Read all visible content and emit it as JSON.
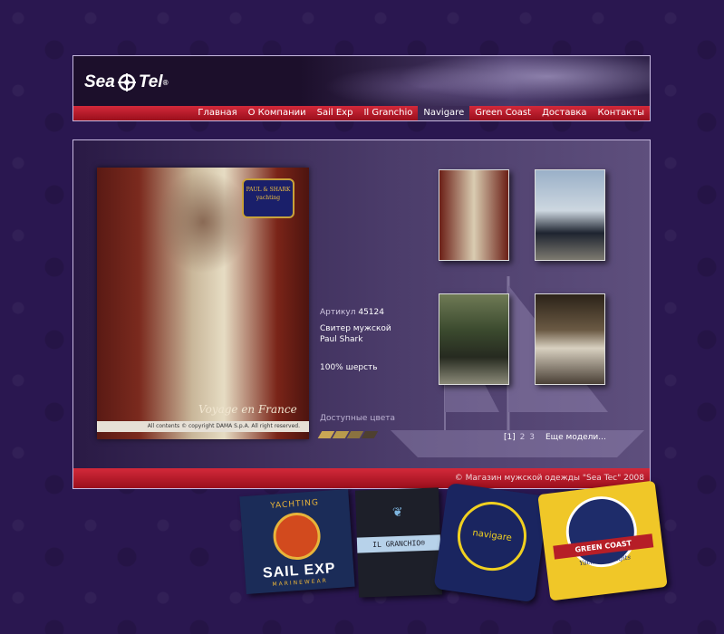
{
  "logo": {
    "text_left": "Sea",
    "text_right": "Tel",
    "mark": "®"
  },
  "nav": {
    "items": [
      {
        "label": "Главная",
        "active": false
      },
      {
        "label": "О Компании",
        "active": false
      },
      {
        "label": "Sail Exp",
        "active": false
      },
      {
        "label": "Il Granchio",
        "active": false
      },
      {
        "label": "Navigare",
        "active": true
      },
      {
        "label": "Green Coast",
        "active": false
      },
      {
        "label": "Доставка",
        "active": false
      },
      {
        "label": "Контакты",
        "active": false
      }
    ]
  },
  "product": {
    "photo": {
      "brand_badge": "PAUL & SHARK yachting",
      "caption": "Voyage en France",
      "copyright": "All contents © copyright DAMA S.p.A. All right reserved."
    },
    "article_label": "Артикул",
    "article_number": "45124",
    "name": "Свитер мужской Paul Shark",
    "material": "100% шерсть",
    "colors_label": "Доступные цвета",
    "colors": [
      "#caa654",
      "#b89a4c",
      "#8a7240",
      "#4e4030"
    ]
  },
  "thumbnails": [
    {
      "icon": "sweater-photo"
    },
    {
      "icon": "jacket-paris-photo"
    },
    {
      "icon": "dark-jacket-photo"
    },
    {
      "icon": "light-jacket-photo"
    }
  ],
  "pager": {
    "pages": [
      "[1]",
      "2",
      "3"
    ],
    "current_index": 0,
    "more_label": "Еще модели..."
  },
  "footer": {
    "text": "© Магазин мужской одежды \"Sea Tec\" 2008"
  },
  "brand_labels": {
    "sail_exp": {
      "top": "YACHTING",
      "name": "SAIL EXP",
      "sub": "MARINEWEAR"
    },
    "il_granchio": {
      "name": "IL GRANCHIO®"
    },
    "navigare": {
      "name": "navigare"
    },
    "green_coast": {
      "name": "GREEN COAST",
      "sub": "Yachting Outfits"
    }
  }
}
